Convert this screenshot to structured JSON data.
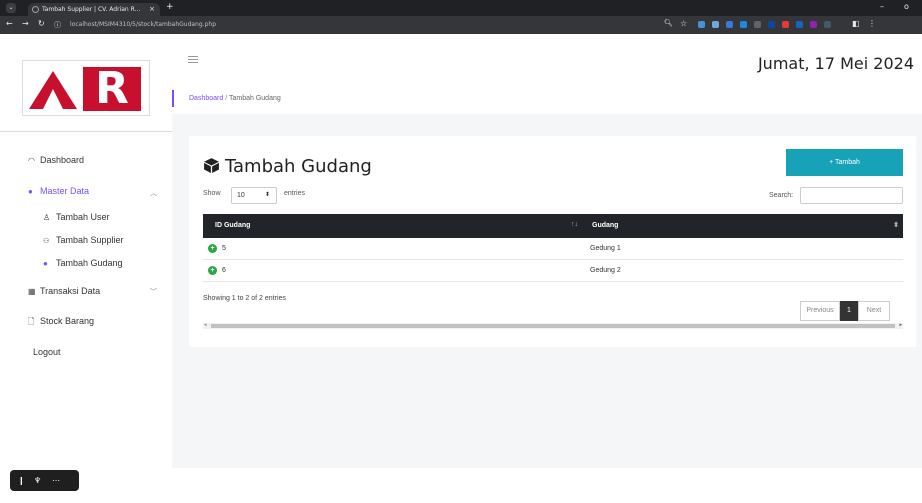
{
  "browser": {
    "tab_title": "Tambah Supplier | CV. Adrian R...",
    "tab_close": "×",
    "new_tab": "+",
    "url": "localhost/MSIM4310/5/stock/tambahGudang.php",
    "minimize": "–",
    "restore": "o"
  },
  "sidebar": {
    "logo_letter": "R",
    "items": [
      {
        "label": "Dashboard",
        "icon": "dashboard-icon"
      },
      {
        "label": "Master Data",
        "icon": "master-data-icon"
      },
      {
        "label": "Transaksi Data",
        "icon": "table-icon"
      },
      {
        "label": "Stock Barang",
        "icon": "file-icon"
      },
      {
        "label": "Logout",
        "icon": ""
      }
    ],
    "sub_items": [
      {
        "label": "Tambah User",
        "icon": "user-icon"
      },
      {
        "label": "Tambah Supplier",
        "icon": "users-icon"
      },
      {
        "label": "Tambah Gudang",
        "icon": "box-icon"
      }
    ]
  },
  "header": {
    "date": "Jumat, 17 Mei 2024"
  },
  "breadcrumb": {
    "home": "Dashboard",
    "separator": "/",
    "current": "Tambah Gudang"
  },
  "card": {
    "title": "Tambah Gudang",
    "add_button": "+ Tambah",
    "show_label": "Show",
    "entries_value": "10",
    "entries_label": "entries",
    "search_label": "Search:",
    "search_value": ""
  },
  "table": {
    "columns": [
      "ID Gudang",
      "Gudang"
    ],
    "rows": [
      {
        "id": "5",
        "gudang": "Gedung 1"
      },
      {
        "id": "6",
        "gudang": "Gedung 2"
      }
    ],
    "info": "Showing 1 to 2 of 2 entries",
    "pager": {
      "previous": "Previous",
      "page": "1",
      "next": "Next"
    }
  },
  "colors": {
    "accent": "#7c4dff",
    "add_button": "#17a2b8",
    "table_header": "#212529",
    "logo_red": "#c8102e",
    "row_dot": "#28a745"
  }
}
